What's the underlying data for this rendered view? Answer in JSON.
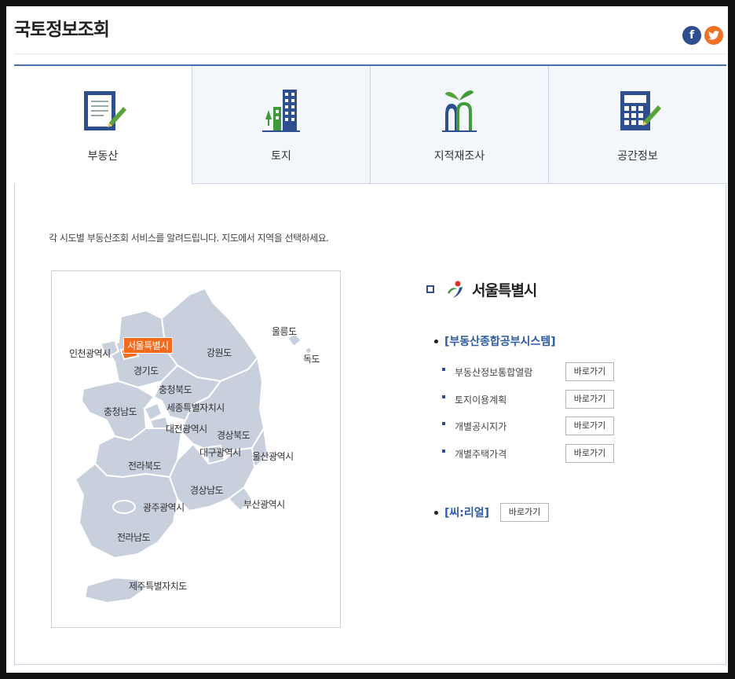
{
  "page_title": "국토정보조회",
  "social": {
    "facebook": "f",
    "twitter": "t"
  },
  "tabs": [
    {
      "label": "부동산",
      "icon": "document-pen-icon",
      "active": true
    },
    {
      "label": "토지",
      "icon": "buildings-icon",
      "active": false
    },
    {
      "label": "지적재조사",
      "icon": "sprout-building-icon",
      "active": false
    },
    {
      "label": "공간정보",
      "icon": "calculator-pen-icon",
      "active": false
    }
  ],
  "description": "각 시도별 부동산조회 서비스를 알려드립니다. 지도에서 지역을 선택하세요.",
  "map_labels": {
    "seoul": "서울특별시",
    "incheon": "인천광역시",
    "gyeonggi": "경기도",
    "gangwon": "강원도",
    "ulleung": "울릉도",
    "dokdo": "독도",
    "chungbuk": "충청북도",
    "chungnam": "충청남도",
    "sejong": "세종특별자치시",
    "daejeon": "대전광역시",
    "gyeongbuk": "경상북도",
    "daegu": "대구광역시",
    "ulsan": "울산광역시",
    "jeonbuk": "전라북도",
    "gyeongnam": "경상남도",
    "gwangju": "광주광역시",
    "busan": "부산광역시",
    "jeonnam": "전라남도",
    "jeju": "제주특별자치도"
  },
  "selected_region": "서울특별시",
  "groups": [
    {
      "title": "[부동산종합공부시스템]",
      "items": [
        {
          "label": "부동산정보통합열람",
          "button": "바로가기"
        },
        {
          "label": "토지이용계획",
          "button": "바로가기"
        },
        {
          "label": "개별공시지가",
          "button": "바로가기"
        },
        {
          "label": "개별주택가격",
          "button": "바로가기"
        }
      ]
    },
    {
      "title": "[씨:리얼]",
      "button": "바로가기"
    }
  ],
  "colors": {
    "accent": "#2d4f8f",
    "selected": "#f26b1d",
    "map_fill": "#c9d0dd",
    "tab_border": "#4a6fb0"
  }
}
